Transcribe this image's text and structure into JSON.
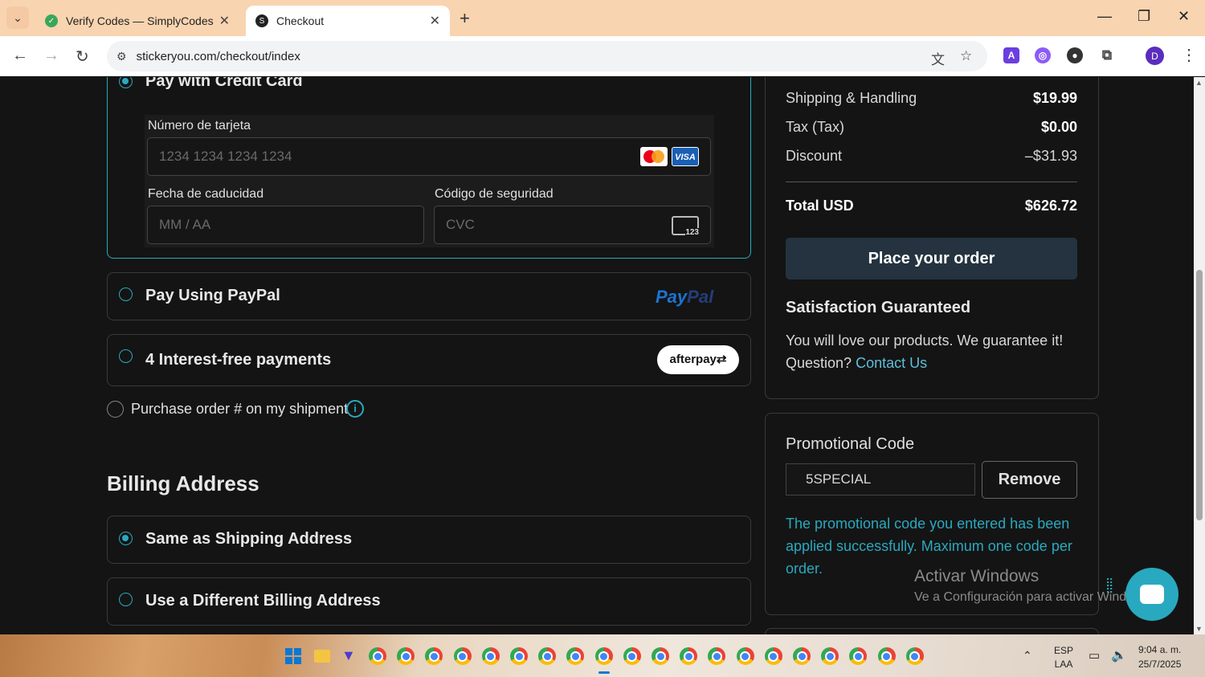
{
  "browser": {
    "tabs": [
      {
        "title": "Verify Codes — SimplyCodes",
        "favicon": "simplycodes-icon",
        "active": false
      },
      {
        "title": "Checkout",
        "favicon": "stickeryou-icon",
        "active": true
      }
    ],
    "url": "stickeryou.com/checkout/index",
    "profile_initial": "D"
  },
  "payment": {
    "credit_card": {
      "label": "Pay with Credit Card",
      "card_number_label": "Número de tarjeta",
      "card_number_placeholder": "1234 1234 1234 1234",
      "expiry_label": "Fecha de caducidad",
      "expiry_placeholder": "MM / AA",
      "cvc_label": "Código de seguridad",
      "cvc_placeholder": "CVC",
      "cvc_icon_text": "123",
      "visa_text": "VISA"
    },
    "paypal": {
      "label": "Pay Using PayPal",
      "logo_pay": "Pay",
      "logo_pal": "Pal"
    },
    "afterpay": {
      "label": "4 Interest-free payments",
      "logo": "afterpay⇄"
    },
    "purchase_order": {
      "label": "Purchase order # on my shipment",
      "info": "i"
    }
  },
  "billing": {
    "title": "Billing Address",
    "options": [
      {
        "label": "Same as Shipping Address",
        "selected": true
      },
      {
        "label": "Use a Different Billing Address",
        "selected": false
      }
    ]
  },
  "summary": {
    "rows": [
      {
        "label": "Shipping & Handling",
        "value": "$19.99"
      },
      {
        "label": "Tax (Tax)",
        "value": "$0.00"
      },
      {
        "label": "Discount",
        "value": "–$31.93"
      }
    ],
    "total_label": "Total USD",
    "total_value": "$626.72",
    "place_order": "Place your order",
    "satisfaction_title": "Satisfaction Guaranteed",
    "satisfaction_text": "You will love our products. We guarantee it!",
    "question": "Question?",
    "contact": "Contact Us"
  },
  "promo": {
    "title": "Promotional Code",
    "value": "5SPECIAL",
    "remove": "Remove",
    "message": "The promotional code you entered has been applied successfully. Maximum one code per order."
  },
  "watermark": {
    "line1": "Activar Windows",
    "line2": "Ve a Configuración para activar Windows."
  },
  "taskbar": {
    "lang": "ESP",
    "layout": "LAA",
    "time": "9:04 a. m.",
    "date": "25/7/2025"
  },
  "colors": {
    "accent": "#29a9bf",
    "page_bg": "#141414",
    "place_button": "#24333f",
    "tabstrip": "#f9d4b0"
  }
}
